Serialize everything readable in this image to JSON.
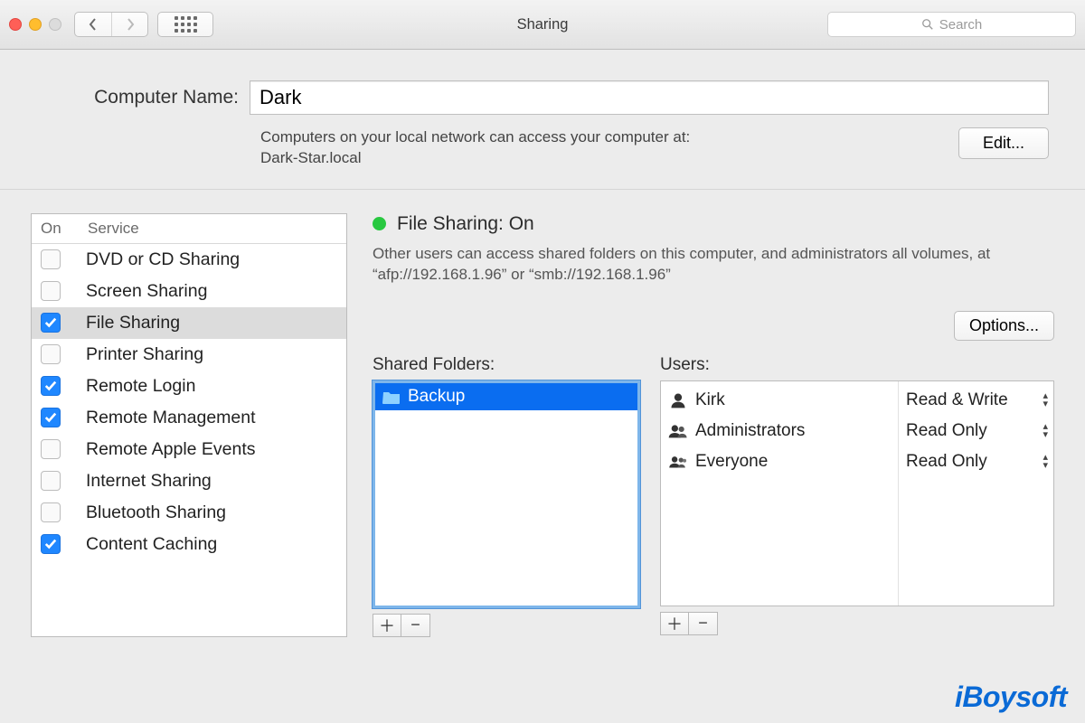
{
  "window": {
    "title": "Sharing",
    "search_placeholder": "Search"
  },
  "computer_name": {
    "label": "Computer Name:",
    "value": "Dark",
    "description_line1": "Computers on your local network can access your computer at:",
    "description_line2": "Dark-Star.local",
    "edit_button": "Edit..."
  },
  "services": {
    "col_on": "On",
    "col_service": "Service",
    "items": [
      {
        "name": "DVD or CD Sharing",
        "on": false,
        "selected": false
      },
      {
        "name": "Screen Sharing",
        "on": false,
        "selected": false
      },
      {
        "name": "File Sharing",
        "on": true,
        "selected": true
      },
      {
        "name": "Printer Sharing",
        "on": false,
        "selected": false
      },
      {
        "name": "Remote Login",
        "on": true,
        "selected": false
      },
      {
        "name": "Remote Management",
        "on": true,
        "selected": false
      },
      {
        "name": "Remote Apple Events",
        "on": false,
        "selected": false
      },
      {
        "name": "Internet Sharing",
        "on": false,
        "selected": false
      },
      {
        "name": "Bluetooth Sharing",
        "on": false,
        "selected": false
      },
      {
        "name": "Content Caching",
        "on": true,
        "selected": false
      }
    ]
  },
  "detail": {
    "status_title": "File Sharing: On",
    "status_description": "Other users can access shared folders on this computer, and administrators all volumes, at “afp://192.168.1.96” or “smb://192.168.1.96”",
    "options_button": "Options...",
    "shared_folders_label": "Shared Folders:",
    "users_label": "Users:",
    "shared_folders": [
      {
        "name": "Backup",
        "selected": true
      }
    ],
    "users": [
      {
        "name": "Kirk",
        "icon": "single",
        "permission": "Read & Write"
      },
      {
        "name": "Administrators",
        "icon": "two",
        "permission": "Read Only"
      },
      {
        "name": "Everyone",
        "icon": "many",
        "permission": "Read Only"
      }
    ]
  },
  "watermark": "iBoysoft"
}
